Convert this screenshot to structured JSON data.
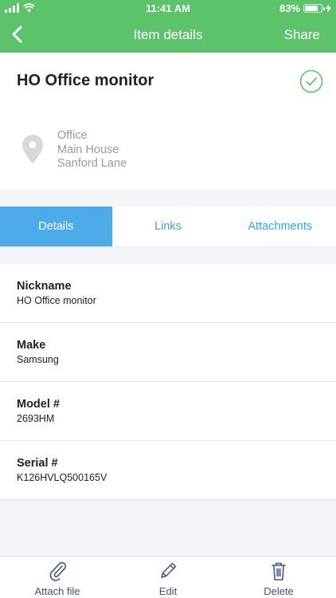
{
  "status_bar": {
    "time": "11:41 AM",
    "battery_text": "83%",
    "battery_level": 0.83
  },
  "nav": {
    "title": "Item details",
    "share_label": "Share",
    "back_icon": "chevron-left-icon"
  },
  "item": {
    "title": "HO Office monitor",
    "status_icon": "check-circle-icon",
    "location": {
      "line1": "Office",
      "line2": "Main House",
      "line3": "Sanford Lane"
    }
  },
  "tabs": [
    {
      "label": "Details",
      "active": true
    },
    {
      "label": "Links",
      "active": false
    },
    {
      "label": "Attachments",
      "active": false
    }
  ],
  "fields": [
    {
      "label": "Nickname",
      "value": "HO Office monitor"
    },
    {
      "label": "Make",
      "value": "Samsung"
    },
    {
      "label": "Model #",
      "value": "2693HM"
    },
    {
      "label": "Serial #",
      "value": "K126HVLQ500165V"
    }
  ],
  "toolbar": {
    "attach_label": "Attach file",
    "edit_label": "Edit",
    "delete_label": "Delete"
  },
  "colors": {
    "header": "#5cc36a",
    "active_tab": "#4dabe9",
    "tab_text": "#3aa3e3",
    "toolbar_text": "#3f4f8f"
  }
}
